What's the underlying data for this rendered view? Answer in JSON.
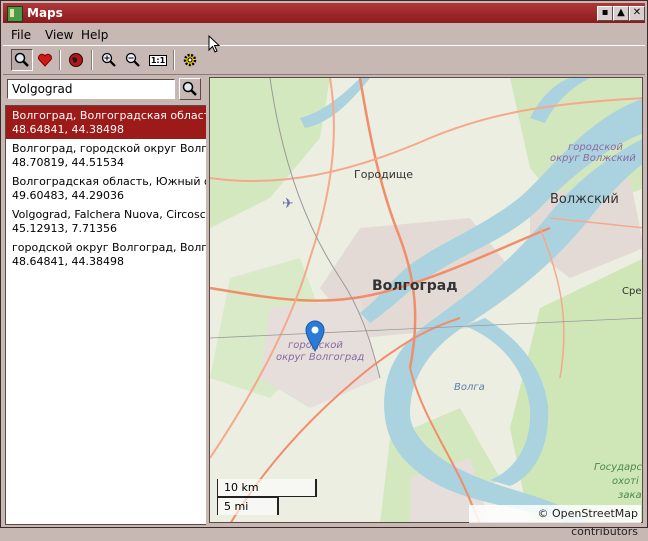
{
  "window": {
    "title": "Maps"
  },
  "title_buttons": {
    "minimize": "▪",
    "maximize": "▲",
    "close": "✕"
  },
  "menu": {
    "file": "File",
    "view": "View",
    "help": "Help"
  },
  "toolbar": {
    "icons": [
      "search-icon",
      "favorite-heart-icon",
      "globe-icon",
      "zoom-in-icon",
      "zoom-out-icon",
      "zoom-1to1-icon",
      "settings-gear-icon"
    ],
    "zoom_1to1_label": "1:1"
  },
  "search": {
    "value": "Volgograd"
  },
  "results": [
    {
      "name": "Волгоград, Волгоградская область, Юж",
      "coords": "48.64841, 44.38498",
      "selected": true
    },
    {
      "name": "Волгоград, городской округ Волгоград",
      "coords": "48.70819, 44.51534",
      "selected": false
    },
    {
      "name": "Волгоградская область, Южный федер",
      "coords": "49.60483, 44.29036",
      "selected": false
    },
    {
      "name": "Volgograd, Falchera Nuova, Circoscri",
      "coords": "45.12913, 7.71356",
      "selected": false
    },
    {
      "name": "городской округ Волгоград, Волгоград",
      "coords": "48.64841, 44.38498",
      "selected": false
    }
  ],
  "map": {
    "labels": {
      "volgograd": "Волгоград",
      "gorodishche": "Городище",
      "volzhsky": "Волжский",
      "okrug_volzhsky_1": "городской",
      "okrug_volzhsky_2": "округ Волжский",
      "okrug_volgograd_1": "городской",
      "okrug_volgograd_2": "округ Волгоград",
      "volga": "Волга",
      "sred": "Сред",
      "gos_1": "Государс",
      "gos_2": "охоті",
      "gos_3": "зака"
    },
    "scale_km": "10 km",
    "scale_mi": "5 mi",
    "attribution": "© OpenStreetMap contributors",
    "colors": {
      "water": "#aad3df",
      "park": "#c8e6b0",
      "urban": "#e2dcd8",
      "road": "#f28d6a"
    }
  }
}
